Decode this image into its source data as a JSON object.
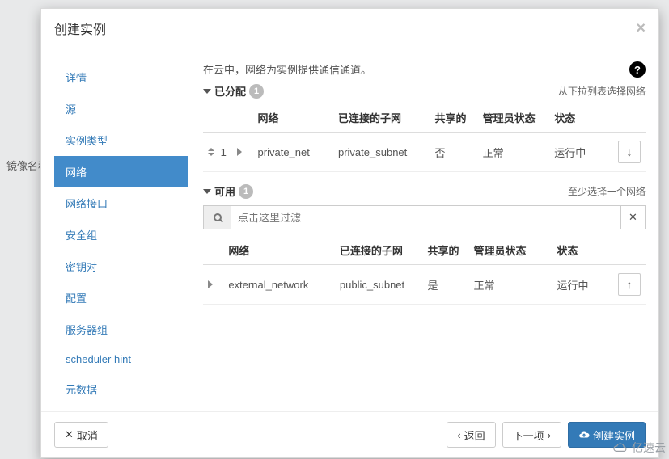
{
  "background": {
    "label": "镜像名称"
  },
  "modal": {
    "title": "创建实例",
    "sidebar": {
      "items": [
        {
          "label": "详情"
        },
        {
          "label": "源"
        },
        {
          "label": "实例类型"
        },
        {
          "label": "网络",
          "active": true
        },
        {
          "label": "网络接口"
        },
        {
          "label": "安全组"
        },
        {
          "label": "密钥对"
        },
        {
          "label": "配置"
        },
        {
          "label": "服务器组"
        },
        {
          "label": "scheduler hint"
        },
        {
          "label": "元数据"
        }
      ]
    },
    "main": {
      "description": "在云中，网络为实例提供通信通道。",
      "allocated": {
        "title": "已分配",
        "count": "1",
        "hint": "从下拉列表选择网络",
        "columns": {
          "network": "网络",
          "subnet": "已连接的子网",
          "shared": "共享的",
          "admin": "管理员状态",
          "status": "状态"
        },
        "rows": [
          {
            "order": "1",
            "network": "private_net",
            "subnet": "private_subnet",
            "shared": "否",
            "admin": "正常",
            "status": "运行中"
          }
        ]
      },
      "available": {
        "title": "可用",
        "count": "1",
        "hint": "至少选择一个网络",
        "filter_placeholder": "点击这里过滤",
        "columns": {
          "network": "网络",
          "subnet": "已连接的子网",
          "shared": "共享的",
          "admin": "管理员状态",
          "status": "状态"
        },
        "rows": [
          {
            "network": "external_network",
            "subnet": "public_subnet",
            "shared": "是",
            "admin": "正常",
            "status": "运行中"
          }
        ]
      }
    },
    "footer": {
      "cancel": "取消",
      "back": "返回",
      "next": "下一项",
      "submit": "创建实例"
    }
  },
  "watermark": "亿速云"
}
